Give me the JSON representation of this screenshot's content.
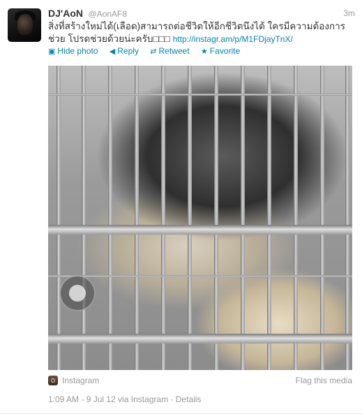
{
  "tweet": {
    "author_name": "DJ'AoN",
    "author_handle": "@AonAF8",
    "timestamp_relative": "3m",
    "text": "สิ่งที่สร้างใหม่ได้(เลือด)สามารถต่อชีวิตให้อีกชีวิตนึงได้ ใครมีความต้องการช่วย โปรดช่วยด้วยน่ะครับ□□□",
    "link": "http://instagr.am/p/M1FDjayTnX/"
  },
  "actions": {
    "hide_photo": "Hide photo",
    "reply": "Reply",
    "retweet": "Retweet",
    "favorite": "Favorite",
    "hide_photo_icon": "photo-icon",
    "reply_icon": "reply-arrow-icon",
    "retweet_icon": "retweet-icon",
    "favorite_icon": "star-icon"
  },
  "media": {
    "source_label": "Instagram",
    "flag_label": "Flag this media",
    "description_icon": "instagram-icon"
  },
  "meta": {
    "details_line": "1:09 AM - 9 Jul 12 via Instagram · Details"
  },
  "colors": {
    "link": "#0084b4",
    "muted": "#999999",
    "text": "#333333"
  }
}
